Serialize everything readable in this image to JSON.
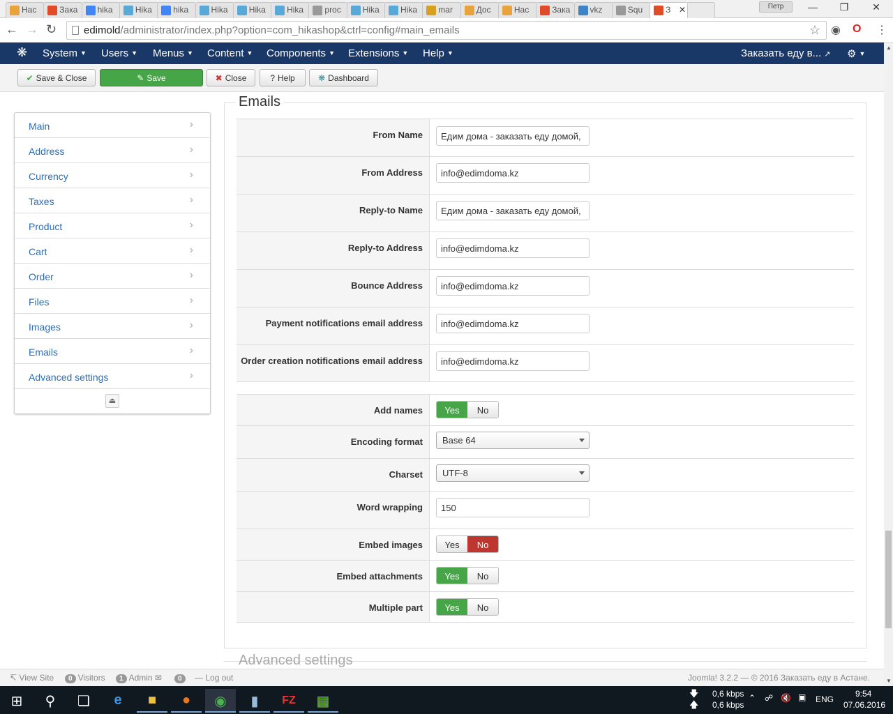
{
  "browser": {
    "tabs": [
      {
        "label": "Нас",
        "color": "#e8a33c"
      },
      {
        "label": "Зака",
        "color": "#e04c2a"
      },
      {
        "label": "hika",
        "color": "#4285f4"
      },
      {
        "label": "Hika",
        "color": "#58a8d8"
      },
      {
        "label": "hika",
        "color": "#4285f4"
      },
      {
        "label": "Hika",
        "color": "#58a8d8"
      },
      {
        "label": "Hika",
        "color": "#58a8d8"
      },
      {
        "label": "Hika",
        "color": "#58a8d8"
      },
      {
        "label": "proc",
        "color": "#999999"
      },
      {
        "label": "Hika",
        "color": "#58a8d8"
      },
      {
        "label": "Hika",
        "color": "#58a8d8"
      },
      {
        "label": "mar",
        "color": "#d8a020"
      },
      {
        "label": "Дос",
        "color": "#e8a33c"
      },
      {
        "label": "Нас",
        "color": "#e8a33c"
      },
      {
        "label": "Зака",
        "color": "#e04c2a"
      },
      {
        "label": "vkz",
        "color": "#3d83c8"
      },
      {
        "label": "Squ",
        "color": "#999999"
      },
      {
        "label": "З",
        "color": "#e04c2a"
      }
    ],
    "profile_name": "Петр",
    "url_host": "edimold",
    "url_path": "/administrator/index.php?option=com_hikashop&ctrl=config#main_emails"
  },
  "menu": {
    "items": [
      "System",
      "Users",
      "Menus",
      "Content",
      "Components",
      "Extensions",
      "Help"
    ],
    "site_link": "Заказать еду в..."
  },
  "toolbar": {
    "save_close": "Save & Close",
    "save": "Save",
    "close": "Close",
    "help": "Help",
    "dashboard": "Dashboard"
  },
  "sidebar": {
    "items": [
      "Main",
      "Address",
      "Currency",
      "Taxes",
      "Product",
      "Cart",
      "Order",
      "Files",
      "Images",
      "Emails",
      "Advanced settings"
    ]
  },
  "emails": {
    "legend": "Emails",
    "fields": [
      {
        "label": "From Name",
        "value": "Едим дома - заказать еду домой,"
      },
      {
        "label": "From Address",
        "value": "info@edimdoma.kz"
      },
      {
        "label": "Reply-to Name",
        "value": "Едим дома - заказать еду домой,"
      },
      {
        "label": "Reply-to Address",
        "value": "info@edimdoma.kz"
      },
      {
        "label": "Bounce Address",
        "value": "info@edimdoma.kz"
      },
      {
        "label": "Payment notifications email address",
        "value": "info@edimdoma.kz"
      },
      {
        "label": "Order creation notifications email address",
        "value": "info@edimdoma.kz"
      }
    ],
    "add_names": {
      "label": "Add names",
      "yes": "Yes",
      "no": "No",
      "value": "Yes"
    },
    "encoding": {
      "label": "Encoding format",
      "value": "Base 64"
    },
    "charset": {
      "label": "Charset",
      "value": "UTF-8"
    },
    "wrapping": {
      "label": "Word wrapping",
      "value": "150"
    },
    "embed_images": {
      "label": "Embed images",
      "yes": "Yes",
      "no": "No",
      "value": "No"
    },
    "embed_attachments": {
      "label": "Embed attachments",
      "yes": "Yes",
      "no": "No",
      "value": "Yes"
    },
    "multiple_part": {
      "label": "Multiple part",
      "yes": "Yes",
      "no": "No",
      "value": "Yes"
    }
  },
  "next_section": "Advanced settings",
  "status": {
    "view_site": "View Site",
    "visitors_count": "0",
    "visitors": "Visitors",
    "admin_count": "1",
    "admin": "Admin",
    "msg_count": "0",
    "logout": "Log out",
    "footer": "Joomla! 3.2.2  —  © 2016 Заказать еду в Астане."
  },
  "taskbar": {
    "net_down": "0,6 kbps",
    "net_up": "0,6 kbps",
    "lang": "ENG",
    "time": "9:54",
    "date": "07.06.2016"
  }
}
